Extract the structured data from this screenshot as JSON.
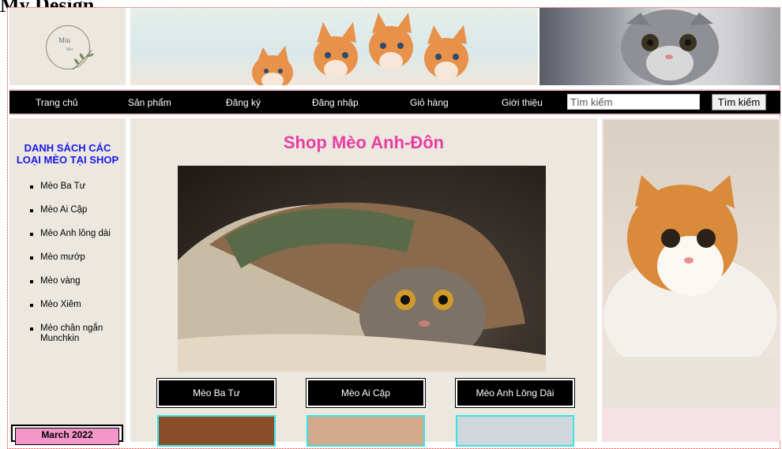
{
  "page_heading": "My Design",
  "logo": {
    "name": "Miu",
    "sub": "Miu"
  },
  "nav": {
    "items": [
      "Trang chủ",
      "Sản phẩm",
      "Đăng ký",
      "Đăng nhập",
      "Giỏ hàng",
      "Giới thiệu"
    ],
    "search_placeholder": "Tìm kiếm",
    "search_button": "Tìm kiếm"
  },
  "sidebar": {
    "title_line1": "DANH SÁCH CÁC",
    "title_line2": "LOẠI MÈO TẠI SHOP",
    "items": [
      "Mèo Ba Tư",
      "Mèo Ai Cập",
      "Mèo Anh lông dài",
      "Mèo mướp",
      "Mèo vàng",
      "Mèo Xiêm",
      "Mèo chân ngắn Munchkin"
    ]
  },
  "calendar": {
    "month": "March 2022"
  },
  "main": {
    "title": "Shop Mèo Anh-Đôn",
    "products": [
      "Mèo Ba Tư",
      "Mèo Ai Cập",
      "Mèo Anh Lông Dài"
    ]
  },
  "colors": {
    "accent_pink": "#e93da1",
    "title_blue": "#1a1ae6",
    "calendar_pink": "#f596cb",
    "thumb_border": "#37e3e3",
    "panel_bg": "#ece7df"
  }
}
